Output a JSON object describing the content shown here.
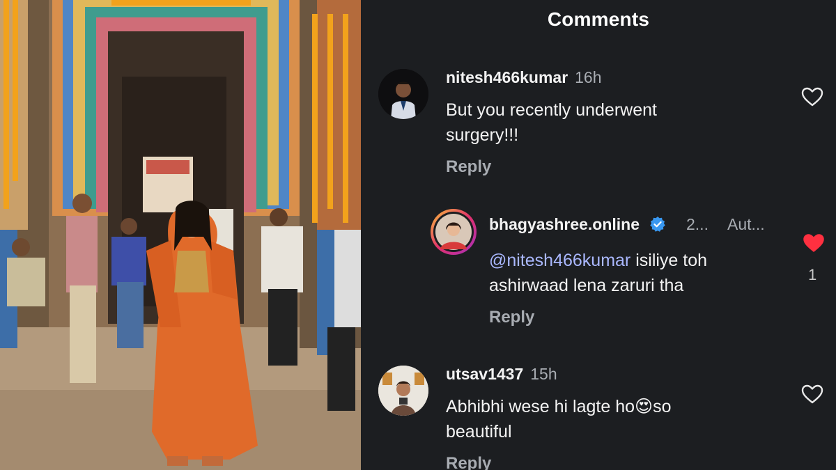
{
  "panel_title": "Comments",
  "comments": [
    {
      "username": "nitesh466kumar",
      "time": "16h",
      "text_lines": [
        "But you recently underwent",
        "surgery!!!"
      ],
      "reply_label": "Reply",
      "liked": false
    },
    {
      "username": "bhagyashree.online",
      "verified": true,
      "time": "2...",
      "author_label": "Aut...",
      "mention": "@nitesh466kumar",
      "text_line1_rest": " isiliye toh",
      "text_line2": "ashirwaad lena zaruri tha",
      "reply_label": "Reply",
      "liked": true,
      "like_count": "1"
    },
    {
      "username": "utsav1437",
      "time": "15h",
      "text_line1_before": "Abhibhi wese hi lagte ho",
      "emoji": "😍",
      "text_line1_after": "so",
      "text_line2": "beautiful",
      "reply_label": "Reply",
      "liked": false
    }
  ],
  "colors": {
    "panel_bg": "#1c1e21",
    "like_red": "#ff3040",
    "verified_blue": "#3897f0",
    "mention": "#aab8ff"
  },
  "icons": [
    "heart-outline-icon",
    "heart-filled-icon",
    "verified-badge-icon"
  ]
}
